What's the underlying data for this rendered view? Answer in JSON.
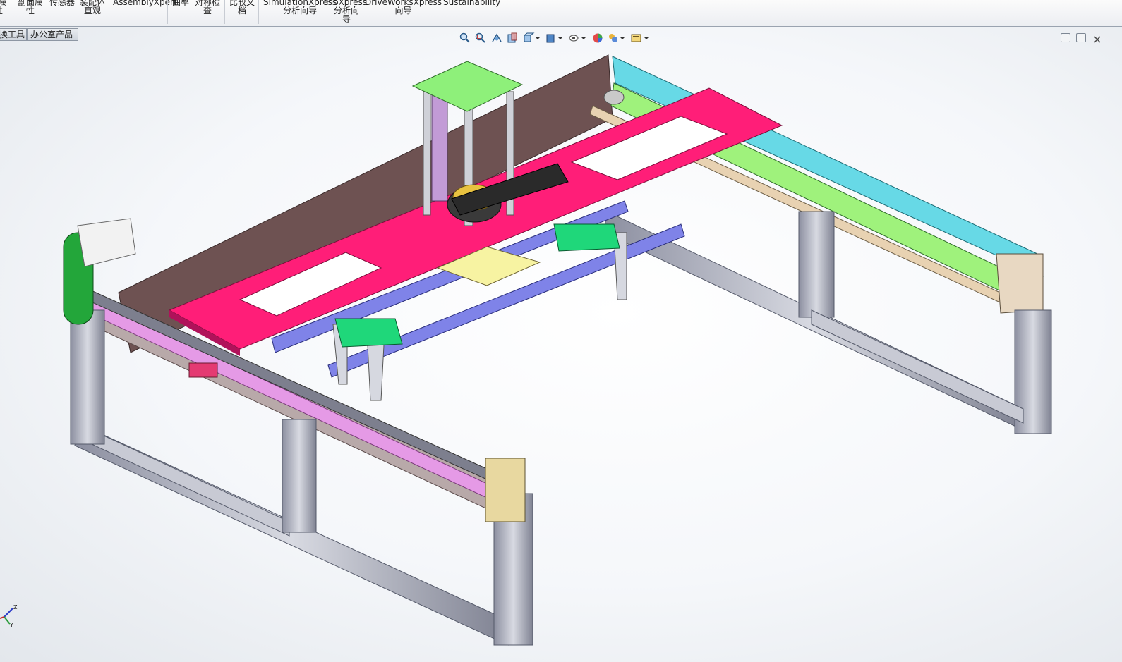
{
  "ribbon": {
    "items": [
      {
        "label": "质属\n性",
        "icon": "mass-properties-icon"
      },
      {
        "label": "剖面属\n性",
        "icon": "section-properties-icon"
      },
      {
        "label": "传感器",
        "icon": "sensor-icon"
      },
      {
        "label": "装配体\n直观",
        "icon": "assembly-visualization-icon"
      },
      {
        "label": "AssemblyXpert",
        "icon": "assemblyxpert-icon"
      },
      {
        "label": "曲率",
        "icon": "curvature-icon"
      },
      {
        "label": "对称检\n查",
        "icon": "symmetry-check-icon"
      },
      {
        "label": "比较文\n档",
        "icon": "compare-documents-icon"
      },
      {
        "label": "SimulationXpress\n分析向导",
        "icon": "simulationxpress-icon"
      },
      {
        "label": "FloXpress\n分析向\n导",
        "icon": "floxpress-icon"
      },
      {
        "label": "DriveWorksXpress\n向导",
        "icon": "driveworksxpress-icon"
      },
      {
        "label": "Sustainability",
        "icon": "sustainability-icon"
      }
    ]
  },
  "tabs": [
    "换工具",
    "办公室产品"
  ],
  "heads_up_toolbar": [
    {
      "name": "zoom-to-fit-icon"
    },
    {
      "name": "zoom-to-area-icon"
    },
    {
      "name": "previous-view-icon"
    },
    {
      "name": "section-view-icon"
    },
    {
      "name": "view-orientation-icon"
    },
    {
      "name": "display-style-icon"
    },
    {
      "name": "hide-show-items-icon"
    },
    {
      "name": "edit-appearance-icon"
    },
    {
      "name": "apply-scene-icon"
    },
    {
      "name": "view-settings-icon"
    }
  ],
  "model": {
    "description": "gantry assembly",
    "colors": {
      "frame": "#b9bcc7",
      "plate": "#ff1e78",
      "back_panel": "#6e5252",
      "beam": "#7f83e8",
      "top_plate": "#8ef07a",
      "block": "#f7f3a2",
      "rail_cyan": "#67d9e6",
      "rail_green": "#9ff27c",
      "rail_tan": "#e8d2b2",
      "rail_magenta": "#e59ae6",
      "belt": "#23a63a",
      "motor": "#f2f2f2"
    }
  },
  "triad": {
    "labels": [
      "Z",
      "Y"
    ]
  }
}
